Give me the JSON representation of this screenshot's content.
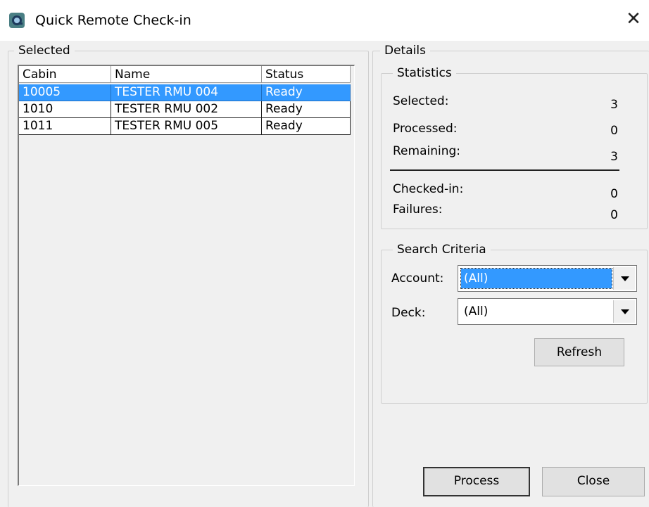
{
  "window": {
    "title": "Quick Remote Check-in"
  },
  "selected_group": {
    "title": "Selected",
    "columns": [
      "Cabin",
      "Name",
      "Status"
    ],
    "rows": [
      {
        "cabin": "10005",
        "name": "TESTER RMU 004",
        "status": "Ready",
        "selected": true
      },
      {
        "cabin": "1010",
        "name": "TESTER RMU 002",
        "status": "Ready",
        "selected": false
      },
      {
        "cabin": "1011",
        "name": "TESTER RMU 005",
        "status": "Ready",
        "selected": false
      }
    ]
  },
  "details": {
    "title": "Details",
    "statistics": {
      "title": "Statistics",
      "selected_label": "Selected:",
      "selected_value": "3",
      "processed_label": "Processed:",
      "processed_value": "0",
      "remaining_label": "Remaining:",
      "remaining_value": "3",
      "checked_in_label": "Checked-in:",
      "checked_in_value": "0",
      "failures_label": "Failures:",
      "failures_value": "0"
    },
    "search": {
      "title": "Search Criteria",
      "account_label": "Account:",
      "account_value": "(All)",
      "deck_label": "Deck:",
      "deck_value": "(All)",
      "refresh_label": "Refresh"
    }
  },
  "buttons": {
    "process": "Process",
    "close": "Close"
  },
  "colors": {
    "selection": "#3399ff",
    "background": "#f0f0f0"
  }
}
